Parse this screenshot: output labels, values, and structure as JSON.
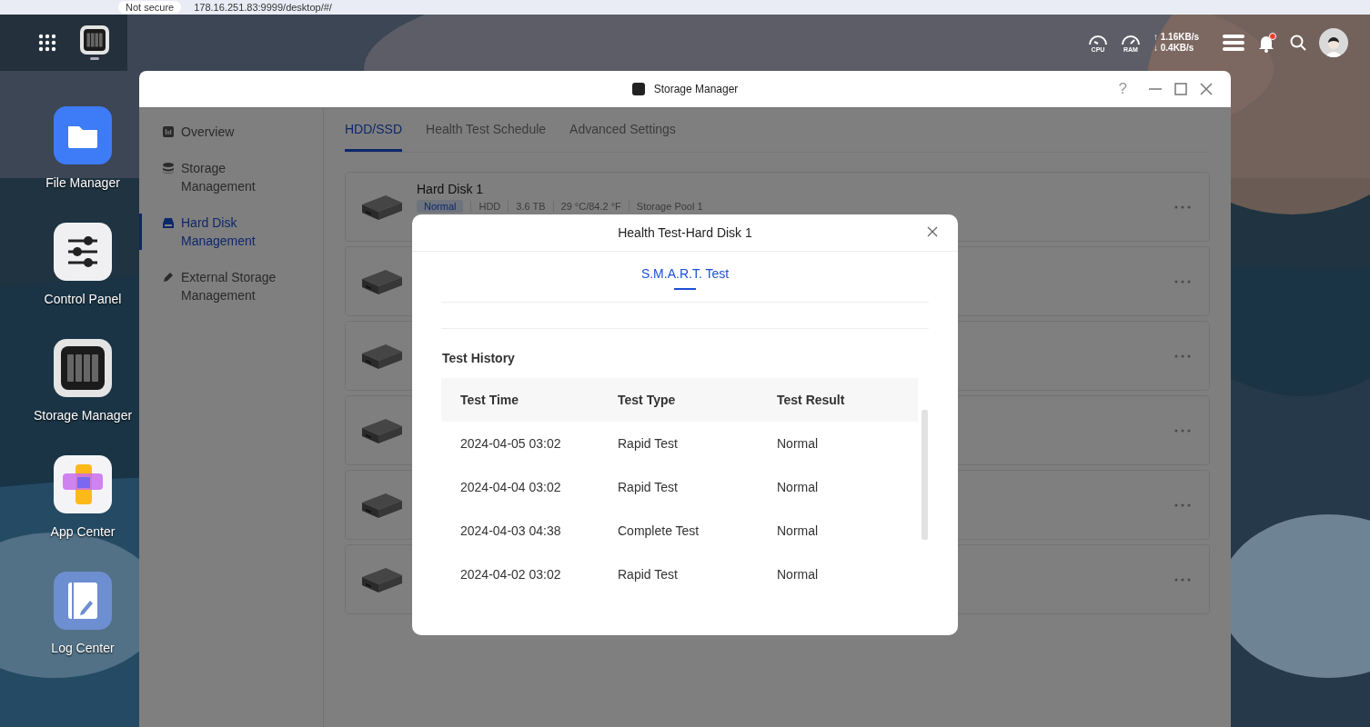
{
  "browser": {
    "security": "Not secure",
    "url": "178.16.251.83:9999/desktop/#/"
  },
  "topbar": {
    "cpu_label": "CPU",
    "ram_label": "RAM",
    "upload": "↑ 1.16KB/s",
    "download": "↓ 0.4KB/s"
  },
  "dock": [
    {
      "label": "File Manager",
      "kind": "folder"
    },
    {
      "label": "Control Panel",
      "kind": "sliders"
    },
    {
      "label": "Storage Manager",
      "kind": "storage"
    },
    {
      "label": "App Center",
      "kind": "apps"
    },
    {
      "label": "Log Center",
      "kind": "log"
    }
  ],
  "window": {
    "title": "Storage Manager",
    "help": "?"
  },
  "sidebar": {
    "items": [
      {
        "label": "Overview",
        "kind": "chart",
        "selected": false
      },
      {
        "label": "Storage Management",
        "kind": "stack",
        "selected": false
      },
      {
        "label": "Hard Disk Management",
        "kind": "disk",
        "selected": true
      },
      {
        "label": "External Storage Management",
        "kind": "pen",
        "selected": false
      }
    ]
  },
  "tabs": [
    {
      "label": "HDD/SSD",
      "selected": true
    },
    {
      "label": "Health Test Schedule",
      "selected": false
    },
    {
      "label": "Advanced Settings",
      "selected": false
    }
  ],
  "disks": [
    {
      "kind": "hdd",
      "name": "Hard Disk 1",
      "status": "Normal",
      "details": [
        "HDD",
        "3.6 TB",
        "29 °C/84.2 °F",
        "Storage Pool 1"
      ]
    },
    {
      "kind": "hdd"
    },
    {
      "kind": "hdd"
    },
    {
      "kind": "hdd"
    },
    {
      "kind": "hdd"
    },
    {
      "kind": "hdd"
    }
  ],
  "dialog": {
    "title": "Health Test-Hard Disk 1",
    "tabs": [
      {
        "label": "S.M.A.R.T. Test",
        "selected": true
      }
    ],
    "section_title": "Test History",
    "columns": [
      "Test Time",
      "Test Type",
      "Test Result"
    ],
    "rows": [
      [
        "2024-04-05 03:02",
        "Rapid Test",
        "Normal"
      ],
      [
        "2024-04-04 03:02",
        "Rapid Test",
        "Normal"
      ],
      [
        "2024-04-03 04:38",
        "Complete Test",
        "Normal"
      ],
      [
        "2024-04-02 03:02",
        "Rapid Test",
        "Normal"
      ]
    ]
  }
}
